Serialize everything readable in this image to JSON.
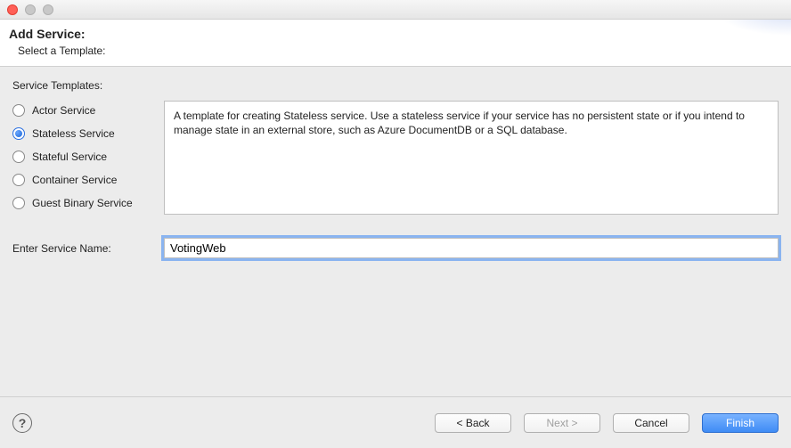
{
  "header": {
    "title": "Add Service:",
    "subtitle": "Select a Template:"
  },
  "group_label": "Service Templates:",
  "templates": {
    "items": [
      {
        "label": "Actor Service"
      },
      {
        "label": "Stateless Service"
      },
      {
        "label": "Stateful Service"
      },
      {
        "label": "Container Service"
      },
      {
        "label": "Guest Binary Service"
      }
    ],
    "selected_index": 1
  },
  "description": "A template for creating Stateless service.  Use a stateless service if your service has no persistent state or if you intend to manage state in an external store, such as Azure DocumentDB or a SQL database.",
  "service_name": {
    "label": "Enter Service Name:",
    "value": "VotingWeb"
  },
  "buttons": {
    "back": "< Back",
    "next": "Next >",
    "cancel": "Cancel",
    "finish": "Finish"
  },
  "help_tooltip": "Help"
}
